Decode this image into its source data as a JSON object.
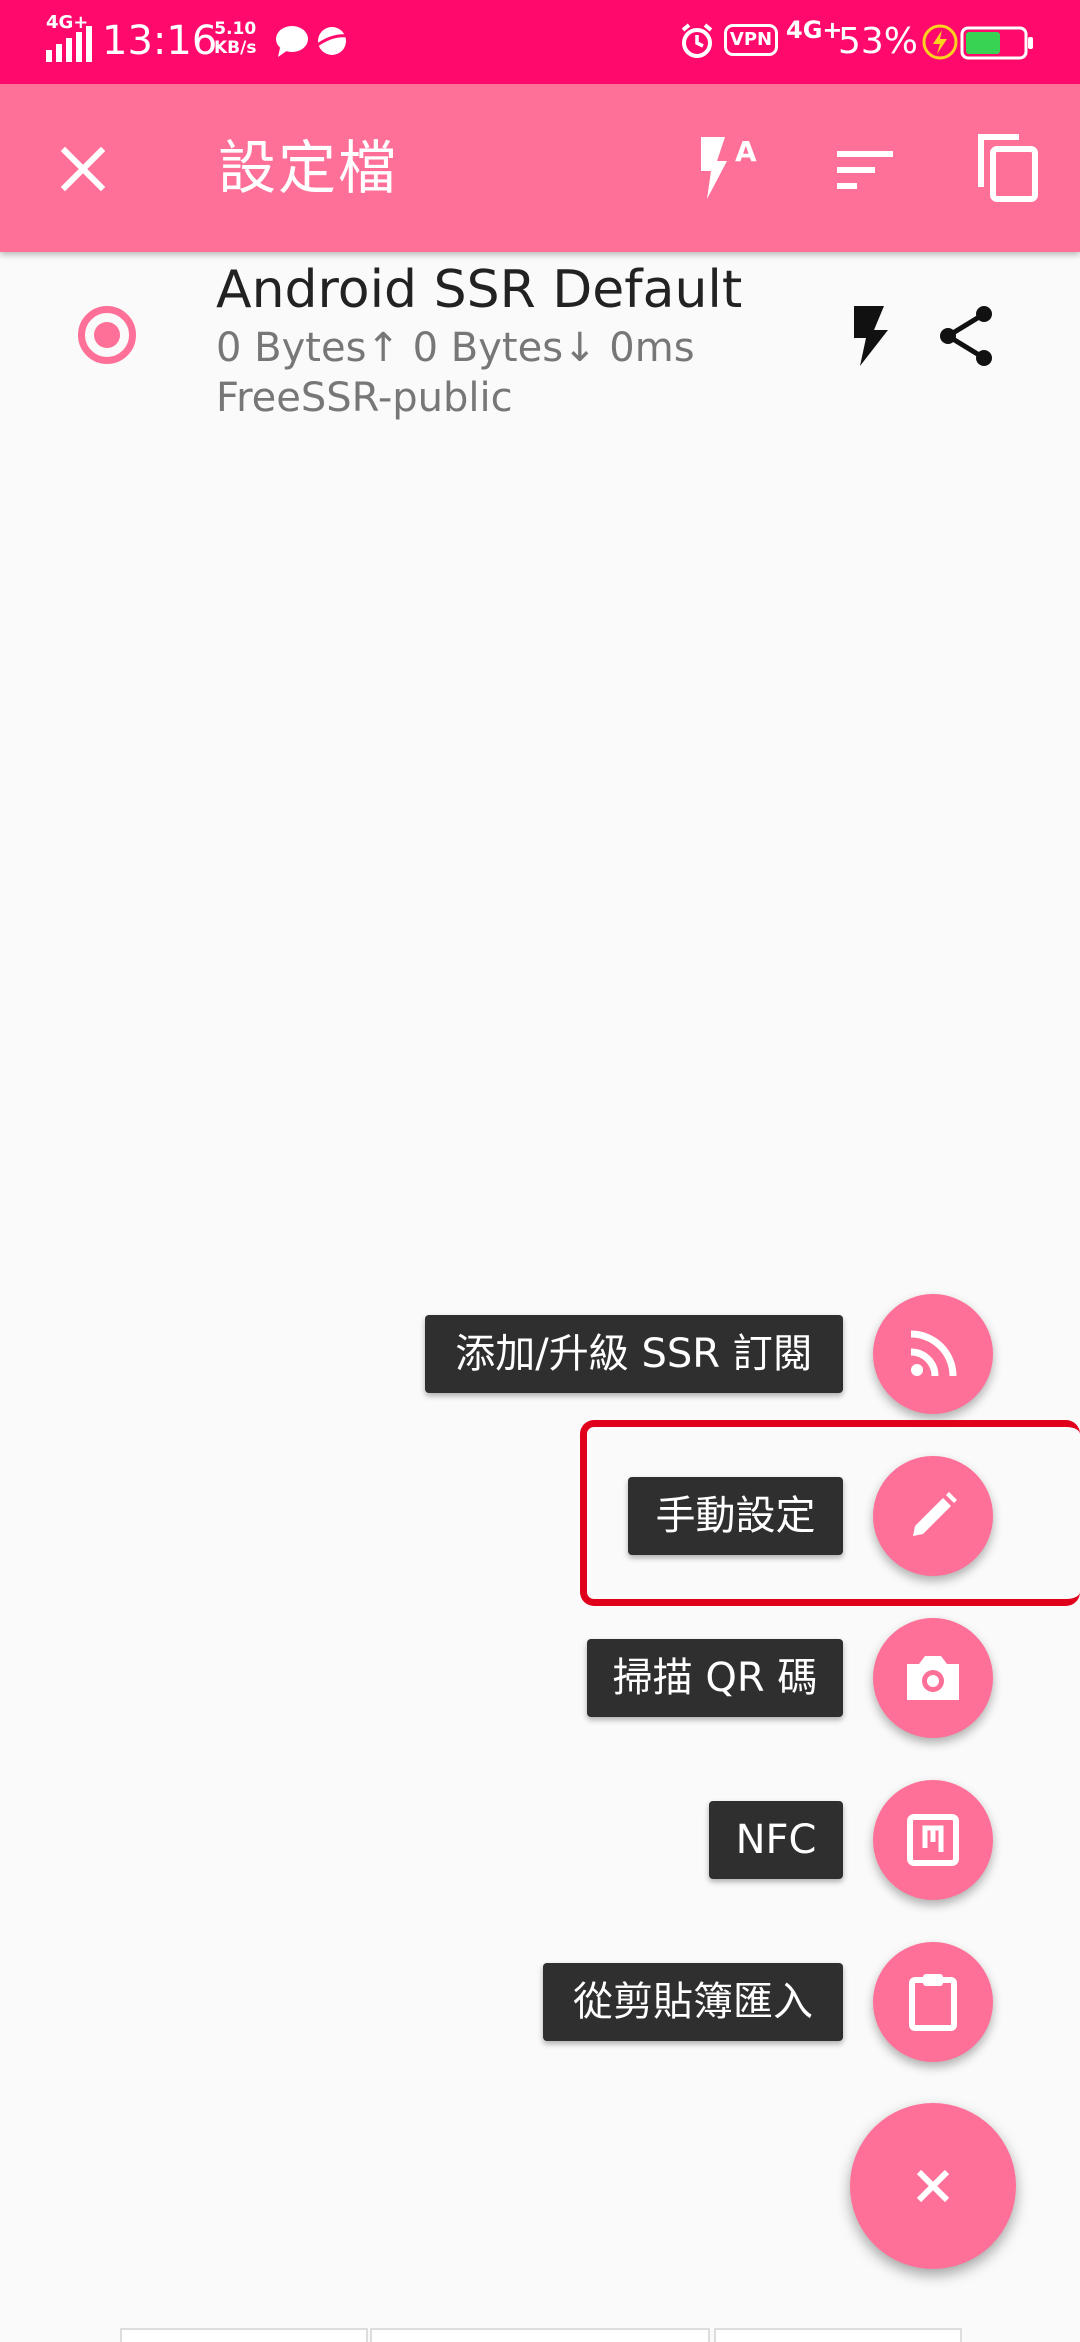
{
  "status_bar": {
    "network_left": "4G+",
    "time": "13:16",
    "speed_value": "5.10",
    "speed_unit": "KB/s",
    "vpn": "VPN",
    "network_right": "4G+",
    "battery": "53%",
    "icons": [
      "signal-icon",
      "chat-bubble-icon",
      "planet-icon",
      "alarm-icon",
      "vpn-icon",
      "lightning-icon",
      "battery-icon"
    ],
    "background_color": "#ff0a6c"
  },
  "toolbar": {
    "title": "設定檔",
    "close_icon": "close-icon",
    "actions": [
      "flash-auto-icon",
      "sort-icon",
      "copy-icon"
    ],
    "color": "#ff7098"
  },
  "profile": {
    "name": "Android SSR Default",
    "stats": "0 Bytes↑  0 Bytes↓  0ms",
    "group": "FreeSSR-public",
    "selected": true
  },
  "speed_dial": {
    "items": [
      {
        "label": "添加/升級 SSR 訂閱",
        "icon": "rss-icon"
      },
      {
        "label": "手動設定",
        "icon": "pencil-icon"
      },
      {
        "label": "掃描 QR 碼",
        "icon": "camera-icon"
      },
      {
        "label": "NFC",
        "icon": "nfc-icon"
      },
      {
        "label": "從剪貼簿匯入",
        "icon": "clipboard-icon"
      }
    ],
    "main_icon": "close-icon",
    "highlight_color": "#e0001b"
  }
}
